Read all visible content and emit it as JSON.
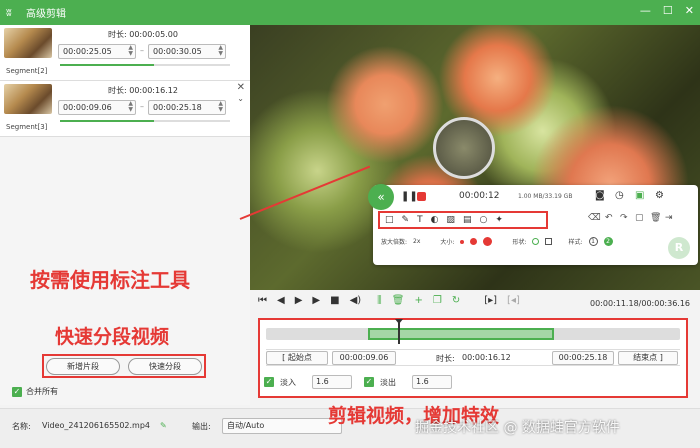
{
  "app": {
    "title": "高级剪辑"
  },
  "segments": [
    {
      "label": "Segment[2]",
      "duration_label": "时长:",
      "duration": "00:00:05.00",
      "start": "00:00:25.05",
      "end": "00:00:30.05",
      "progress": 0.55
    },
    {
      "label": "Segment[3]",
      "duration_label": "时长:",
      "duration": "00:00:16.12",
      "start": "00:00:09.06",
      "end": "00:00:25.18",
      "progress": 0.55
    }
  ],
  "left_buttons": {
    "new_segment": "新增片段",
    "quick_segment": "快速分段"
  },
  "merge": {
    "label": "合并所有",
    "checked": true
  },
  "recorder": {
    "time": "00:00:12",
    "size": "1.00 MB/33.19 GB",
    "zoom_label": "放大倍数:",
    "zoom_value": "2x",
    "size_label": "大小:",
    "shape_label": "形状:",
    "style_label": "样式:",
    "style_1": "1",
    "style_2": "2"
  },
  "captions": {
    "annotation": "按需使用标注工具",
    "segmentation": "快速分段视频",
    "editing": "剪辑视频，增加特效"
  },
  "timecode": "00:00:11.18/00:00:36.16",
  "timeline": {
    "start_label": "起始点",
    "start_value": "00:00:09.06",
    "duration_label": "时长:",
    "duration_value": "00:00:16.12",
    "end_value": "00:00:25.18",
    "end_label": "结束点",
    "fade_in_label": "淡入",
    "fade_in_value": "1.6",
    "fade_out_label": "淡出",
    "fade_out_value": "1.6"
  },
  "bottom": {
    "name_label": "名称:",
    "file_name": "Video_241206165502.mp4",
    "output_label": "输出:",
    "output_value": "自动/Auto"
  },
  "watermark": "掘金技术社区 @ 数据蛙官方软件",
  "colors": {
    "accent": "#4caf50",
    "highlight": "#e53935"
  }
}
